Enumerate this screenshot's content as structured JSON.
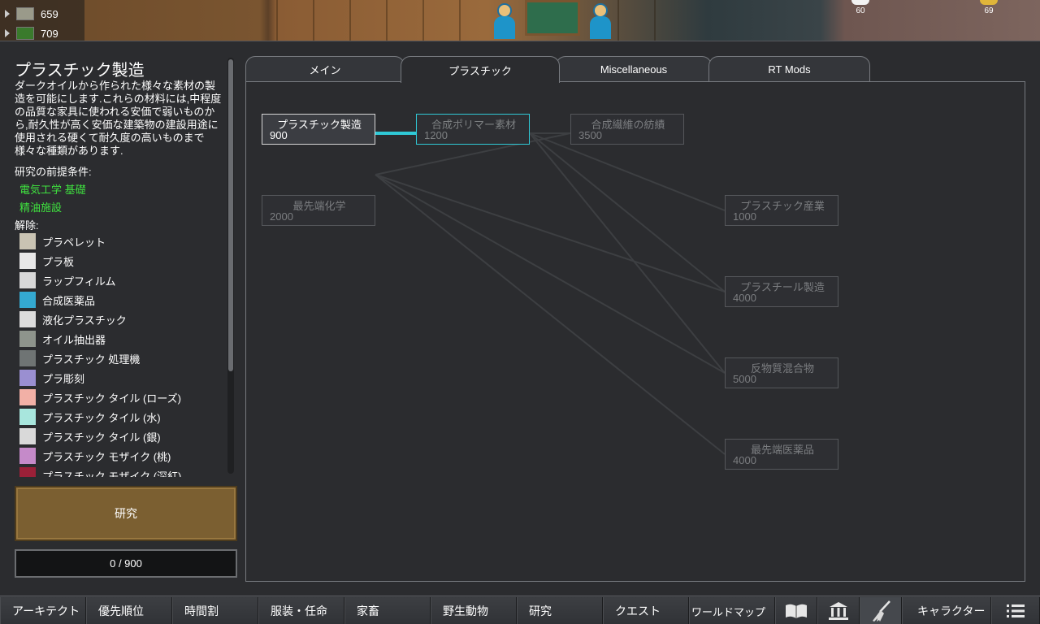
{
  "resources": [
    {
      "icon": "silver-icon",
      "count": "659"
    },
    {
      "icon": "berries-icon",
      "count": "709"
    }
  ],
  "stack_counts": {
    "left": "60",
    "right": "69"
  },
  "project": {
    "title": "プラスチック製造",
    "description": "ダークオイルから作られた様々な素材の製造を可能にします.これらの材料には,中程度の品質な家具に使われる安価で弱いものから,耐久性が高く安価な建築物の建設用途に使用される硬くて耐久度の高いものまで様々な種類があります.",
    "prereq_label": "研究の前提条件:",
    "prerequisites": [
      "電気工学 基礎",
      "精油施設"
    ],
    "unlock_label": "解除:",
    "unlocks": [
      {
        "label": "プラペレット",
        "icon": "pellet-icon",
        "color": "#c9c3b3"
      },
      {
        "label": "プラ板",
        "icon": "plastic-sheet-icon",
        "color": "#e8e8e8"
      },
      {
        "label": "ラップフィルム",
        "icon": "wrap-film-icon",
        "color": "#d8d8d8"
      },
      {
        "label": "合成医薬品",
        "icon": "synthetic-medicine-icon",
        "color": "#34a9d1"
      },
      {
        "label": "液化プラスチック",
        "icon": "liquid-plastic-icon",
        "color": "#dcdcdc"
      },
      {
        "label": "オイル抽出器",
        "icon": "oil-extractor-icon",
        "color": "#8e948c"
      },
      {
        "label": "プラスチック 処理機",
        "icon": "plastic-processor-icon",
        "color": "#6f7474"
      },
      {
        "label": "プラ彫刻",
        "icon": "plastic-sculpture-icon",
        "color": "#9a8fd1"
      },
      {
        "label": "プラスチック タイル (ローズ)",
        "icon": "tile-rose-icon",
        "color": "#f2b0a6"
      },
      {
        "label": "プラスチック タイル (水)",
        "icon": "tile-water-icon",
        "color": "#a8e6dd"
      },
      {
        "label": "プラスチック タイル (銀)",
        "icon": "tile-silver-icon",
        "color": "#d9d9d9"
      },
      {
        "label": "プラスチック モザイク (桃)",
        "icon": "mosaic-peach-icon",
        "color": "#c58ac9"
      },
      {
        "label": "プラスチック モザイク (深紅)",
        "icon": "mosaic-crimson-icon",
        "color": "#9b2038"
      }
    ],
    "research_button": "研究",
    "progress_text": "0 / 900",
    "progress": 0
  },
  "tabs": [
    {
      "label": "メイン",
      "active": false
    },
    {
      "label": "プラスチック",
      "active": true
    },
    {
      "label": "Miscellaneous",
      "active": false
    },
    {
      "label": "RT Mods",
      "active": false
    }
  ],
  "nodes": [
    {
      "name": "プラスチック製造",
      "cost": "900",
      "state": "selected"
    },
    {
      "name": "合成ポリマー素材",
      "cost": "1200",
      "state": "available"
    },
    {
      "name": "合成繊維の紡績",
      "cost": "3500",
      "state": "locked"
    },
    {
      "name": "最先端化学",
      "cost": "2000",
      "state": "locked"
    },
    {
      "name": "プラスチック産業",
      "cost": "1000",
      "state": "locked"
    },
    {
      "name": "プラスチール製造",
      "cost": "4000",
      "state": "locked"
    },
    {
      "name": "反物質混合物",
      "cost": "5000",
      "state": "locked"
    },
    {
      "name": "最先端医薬品",
      "cost": "4000",
      "state": "locked"
    }
  ],
  "bottom_bar": [
    {
      "label": "アーキテクト"
    },
    {
      "label": "優先順位"
    },
    {
      "label": "時間割"
    },
    {
      "label": "服装・任命"
    },
    {
      "label": "家畜"
    },
    {
      "label": "野生動物"
    },
    {
      "label": "研究"
    },
    {
      "label": "クエスト"
    },
    {
      "label": "ワールドマップ"
    },
    {
      "label": "キャラクター"
    }
  ],
  "bottom_icons": [
    "book-icon",
    "history-icon",
    "broom-icon",
    "menu-icon"
  ],
  "colors": {
    "prereq_green": "#3fe23f",
    "available_cyan": "#2fc9d6",
    "research_button": "#7b5f31"
  }
}
